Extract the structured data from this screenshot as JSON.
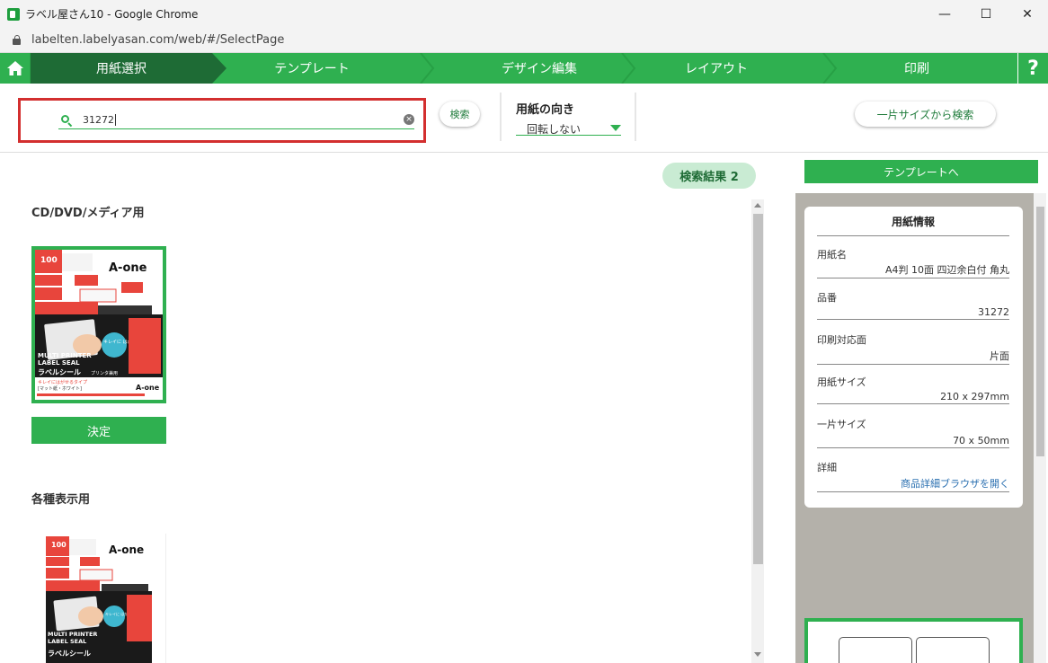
{
  "window": {
    "title": "ラベル屋さん10 - Google Chrome",
    "url": "labelten.labelyasan.com/web/#/SelectPage",
    "minimize": "—",
    "maximize": "☐",
    "close": "✕"
  },
  "steps": [
    {
      "label": "用紙選択",
      "active": true
    },
    {
      "label": "テンプレート"
    },
    {
      "label": "デザイン編集"
    },
    {
      "label": "レイアウト"
    },
    {
      "label": "印刷"
    }
  ],
  "help": "?",
  "search": {
    "value": "31272",
    "button": "検索",
    "orientation_label": "用紙の向き",
    "orientation_value": "回転しない",
    "size_search_button": "一片サイズから検索"
  },
  "results": {
    "badge": "検索結果 2",
    "categories": [
      {
        "name": "CD/DVD/メディア用",
        "decide_label": "決定"
      },
      {
        "name": "各種表示用"
      }
    ]
  },
  "product": {
    "brand": "A-one",
    "top_count": "100",
    "title_en_1": "MULTI PRINTER",
    "title_en_2": "LABEL SEAL",
    "title_jp": "ラベルシール",
    "badge": "キレイに はがせる",
    "sub": "キレイにはがせるタイプ",
    "finish": "[マット紙・ホワイト]",
    "printer": "プリンタ兼用"
  },
  "right_panel": {
    "template_button": "テンプレートへ",
    "info_title": "用紙情報",
    "fields": [
      {
        "label": "用紙名",
        "value": "A4判 10面 四辺余白付 角丸"
      },
      {
        "label": "品番",
        "value": "31272"
      },
      {
        "label": "印刷対応面",
        "value": "片面"
      },
      {
        "label": "用紙サイズ",
        "value": "210 x 297mm"
      },
      {
        "label": "一片サイズ",
        "value": "70 x 50mm"
      },
      {
        "label": "詳細",
        "value": "商品詳細ブラウザを開く"
      }
    ]
  },
  "colors": {
    "brand_green": "#2fb050",
    "active_step": "#1e6b35",
    "highlight_red": "#d32f2f"
  }
}
